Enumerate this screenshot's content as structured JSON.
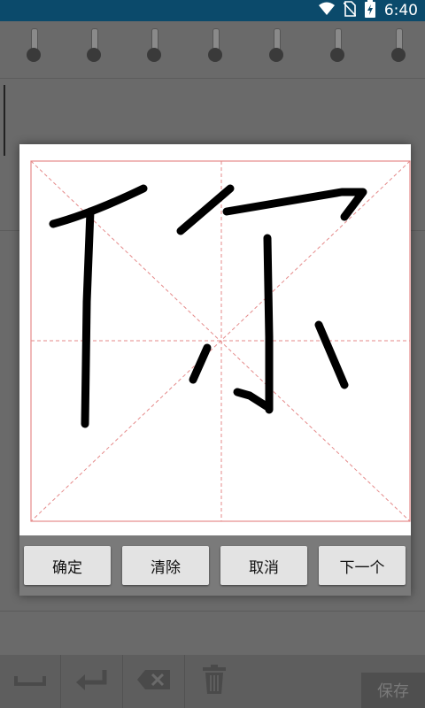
{
  "status_bar": {
    "time": "6:40"
  },
  "icons": {
    "wifi": "wifi-icon",
    "no_sim": "no-sim-icon",
    "battery": "battery-charging-icon",
    "space": "space-icon",
    "enter": "enter-icon",
    "backspace": "backspace-icon",
    "trash": "trash-icon"
  },
  "dialog": {
    "character_drawn": "你",
    "buttons": [
      "确定",
      "清除",
      "取消",
      "下一个"
    ]
  },
  "toolbar": {
    "save_label": "保存"
  },
  "colors": {
    "status_bar": "#0b4a6b",
    "grid_lines": "#e58a8a",
    "ink": "#000000"
  }
}
